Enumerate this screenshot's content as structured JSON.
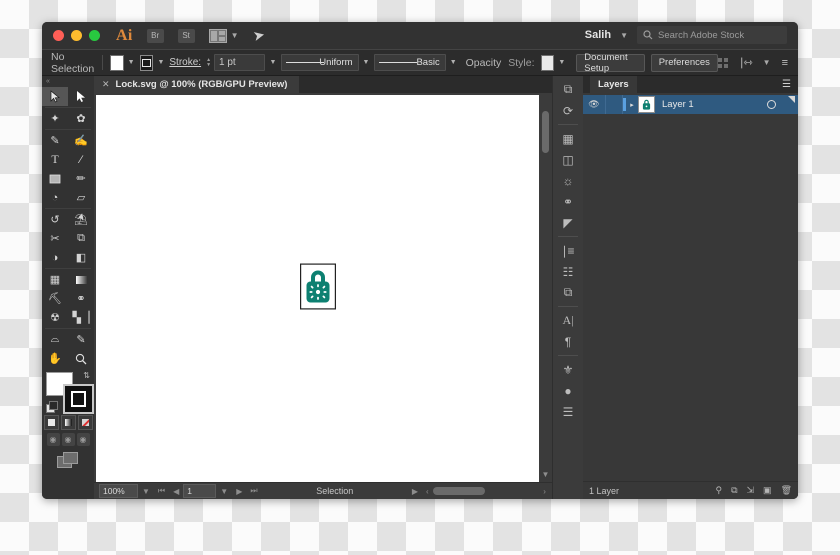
{
  "window": {
    "app_name": "Ai",
    "buttons": {
      "bridge": "Br",
      "stock": "St"
    },
    "user": "Salih",
    "stock_search_placeholder": "Search Adobe Stock"
  },
  "control_bar": {
    "selection_status": "No Selection",
    "stroke_label": "Stroke:",
    "stroke_weight": "1 pt",
    "variable_width_profile": "Uniform",
    "brush_definition": "Basic",
    "opacity_label": "Opacity",
    "style_label": "Style:",
    "document_setup": "Document Setup",
    "preferences": "Preferences"
  },
  "tools": {
    "collapse": "«",
    "items": [
      {
        "name": "selection-tool",
        "glyph": "➤",
        "selected": true
      },
      {
        "name": "direct-selection-tool",
        "glyph": "➤",
        "selected": false
      },
      {
        "name": "magic-wand-tool",
        "glyph": "✦",
        "selected": false
      },
      {
        "name": "lasso-tool",
        "glyph": "❀",
        "selected": false
      },
      {
        "name": "pen-tool",
        "glyph": "✒",
        "selected": false
      },
      {
        "name": "curvature-tool",
        "glyph": "✎",
        "selected": false
      },
      {
        "name": "type-tool",
        "glyph": "T",
        "selected": false
      },
      {
        "name": "line-segment-tool",
        "glyph": "/",
        "selected": false
      },
      {
        "name": "rectangle-tool",
        "glyph": "■",
        "selected": false
      },
      {
        "name": "paintbrush-tool",
        "glyph": "✐",
        "selected": false
      },
      {
        "name": "shaper-tool",
        "glyph": "◔",
        "selected": false
      },
      {
        "name": "eraser-tool",
        "glyph": "▱",
        "selected": false
      },
      {
        "name": "rotate-tool",
        "glyph": "↺",
        "selected": false
      },
      {
        "name": "scale-tool",
        "glyph": "◱",
        "selected": false
      },
      {
        "name": "width-tool",
        "glyph": "✂",
        "selected": false
      },
      {
        "name": "free-transform-tool",
        "glyph": "⧉",
        "selected": false
      },
      {
        "name": "shape-builder-tool",
        "glyph": "◑",
        "selected": false
      },
      {
        "name": "perspective-grid-tool",
        "glyph": "◧",
        "selected": false
      },
      {
        "name": "mesh-tool",
        "glyph": "▦",
        "selected": false
      },
      {
        "name": "gradient-tool",
        "glyph": "▤",
        "selected": false
      },
      {
        "name": "eyedropper-tool",
        "glyph": "⚗",
        "selected": false
      },
      {
        "name": "blend-tool",
        "glyph": "⚭",
        "selected": false
      },
      {
        "name": "symbol-sprayer-tool",
        "glyph": "☸",
        "selected": false
      },
      {
        "name": "column-graph-tool",
        "glyph": "█",
        "selected": false
      },
      {
        "name": "artboard-tool",
        "glyph": "⌑",
        "selected": false
      },
      {
        "name": "slice-tool",
        "glyph": "✒",
        "selected": false
      },
      {
        "name": "hand-tool",
        "glyph": "✋",
        "selected": false
      },
      {
        "name": "zoom-tool",
        "glyph": "⚲",
        "selected": false
      }
    ]
  },
  "document": {
    "tab_title": "Lock.svg @ 100% (RGB/GPU Preview)",
    "artwork": {
      "name": "padlock",
      "fill_color": "#0d8071",
      "stroke_color": "#000000"
    }
  },
  "status_bar": {
    "zoom": "100%",
    "page": "1",
    "status": "Selection"
  },
  "dock": {
    "icons": [
      "properties-icon",
      "libraries-icon",
      "swatches-icon",
      "gradient-icon",
      "color-icon",
      "color-guide-icon",
      "brushes-icon",
      "align-icon",
      "transform-icon",
      "pathfinder-icon",
      "character-icon",
      "paragraph-icon",
      "symbols-icon",
      "appearance-icon",
      "layers-menu-icon"
    ]
  },
  "layers_panel": {
    "title": "Layers",
    "menu_icon": "panel-menu-icon",
    "rows": [
      {
        "name": "Layer 1",
        "visible": true,
        "selected": true,
        "thumbnail": "padlock-thumbnail"
      }
    ],
    "footer_count": "1 Layer",
    "footer_icons": [
      "locate-object-icon",
      "make-clipping-mask-icon",
      "create-new-sublayer-icon",
      "create-new-layer-icon",
      "delete-selection-icon"
    ]
  },
  "colors": {
    "window_chrome": "#323232",
    "panel_bg": "#383838",
    "selection_blue": "#2f5a80",
    "accent_orange": "#e08a3c",
    "artwork_teal": "#0d8071"
  }
}
